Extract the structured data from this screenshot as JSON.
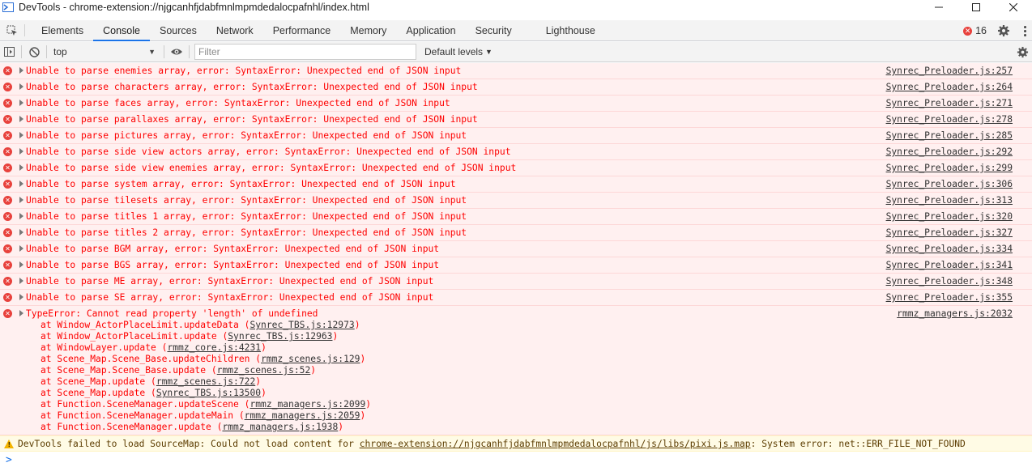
{
  "window": {
    "title": "DevTools - chrome-extension://njgcanhfjdabfmnlmpmdedalocpafnhl/index.html"
  },
  "tabs": [
    {
      "label": "Elements"
    },
    {
      "label": "Console"
    },
    {
      "label": "Sources"
    },
    {
      "label": "Network"
    },
    {
      "label": "Performance"
    },
    {
      "label": "Memory"
    },
    {
      "label": "Application"
    },
    {
      "label": "Security"
    },
    {
      "label": "Lighthouse"
    }
  ],
  "active_tab": "Console",
  "error_count": "16",
  "toolbar": {
    "context": "top",
    "filter_placeholder": "Filter",
    "levels": "Default levels"
  },
  "errors": [
    {
      "text": "Unable to parse enemies array, error: SyntaxError: Unexpected end of JSON input",
      "source": "Synrec_Preloader.js:257"
    },
    {
      "text": "Unable to parse characters array, error: SyntaxError: Unexpected end of JSON input",
      "source": "Synrec_Preloader.js:264"
    },
    {
      "text": "Unable to parse faces array, error: SyntaxError: Unexpected end of JSON input",
      "source": "Synrec_Preloader.js:271"
    },
    {
      "text": "Unable to parse parallaxes array, error: SyntaxError: Unexpected end of JSON input",
      "source": "Synrec_Preloader.js:278"
    },
    {
      "text": "Unable to parse pictures array, error: SyntaxError: Unexpected end of JSON input",
      "source": "Synrec_Preloader.js:285"
    },
    {
      "text": "Unable to parse side view actors array, error: SyntaxError: Unexpected end of JSON input",
      "source": "Synrec_Preloader.js:292"
    },
    {
      "text": "Unable to parse side view enemies array, error: SyntaxError: Unexpected end of JSON input",
      "source": "Synrec_Preloader.js:299"
    },
    {
      "text": "Unable to parse system array, error: SyntaxError: Unexpected end of JSON input",
      "source": "Synrec_Preloader.js:306"
    },
    {
      "text": "Unable to parse tilesets array, error: SyntaxError: Unexpected end of JSON input",
      "source": "Synrec_Preloader.js:313"
    },
    {
      "text": "Unable to parse titles 1 array, error: SyntaxError: Unexpected end of JSON input",
      "source": "Synrec_Preloader.js:320"
    },
    {
      "text": "Unable to parse titles 2 array, error: SyntaxError: Unexpected end of JSON input",
      "source": "Synrec_Preloader.js:327"
    },
    {
      "text": "Unable to parse BGM array, error: SyntaxError: Unexpected end of JSON input",
      "source": "Synrec_Preloader.js:334"
    },
    {
      "text": "Unable to parse BGS array, error: SyntaxError: Unexpected end of JSON input",
      "source": "Synrec_Preloader.js:341"
    },
    {
      "text": "Unable to parse ME array, error: SyntaxError: Unexpected end of JSON input",
      "source": "Synrec_Preloader.js:348"
    },
    {
      "text": "Unable to parse SE array, error: SyntaxError: Unexpected end of JSON input",
      "source": "Synrec_Preloader.js:355"
    }
  ],
  "type_error": {
    "text": "TypeError: Cannot read property 'length' of undefined",
    "source": "rmmz_managers.js:2032",
    "frames": [
      {
        "pre": "at Window_ActorPlaceLimit.updateData (",
        "link": "Synrec_TBS.js:12973",
        "post": ")"
      },
      {
        "pre": "at Window_ActorPlaceLimit.update (",
        "link": "Synrec_TBS.js:12963",
        "post": ")"
      },
      {
        "pre": "at WindowLayer.update (",
        "link": "rmmz_core.js:4231",
        "post": ")"
      },
      {
        "pre": "at Scene_Map.Scene_Base.updateChildren (",
        "link": "rmmz_scenes.js:129",
        "post": ")"
      },
      {
        "pre": "at Scene_Map.Scene_Base.update (",
        "link": "rmmz_scenes.js:52",
        "post": ")"
      },
      {
        "pre": "at Scene_Map.update (",
        "link": "rmmz_scenes.js:722",
        "post": ")"
      },
      {
        "pre": "at Scene_Map.update (",
        "link": "Synrec_TBS.js:13500",
        "post": ")"
      },
      {
        "pre": "at Function.SceneManager.updateScene (",
        "link": "rmmz_managers.js:2099",
        "post": ")"
      },
      {
        "pre": "at Function.SceneManager.updateMain (",
        "link": "rmmz_managers.js:2059",
        "post": ")"
      },
      {
        "pre": "at Function.SceneManager.update (",
        "link": "rmmz_managers.js:1938",
        "post": ")"
      }
    ]
  },
  "warning": {
    "pre": "DevTools failed to load SourceMap: Could not load content for ",
    "link": "chrome-extension://njgcanhfjdabfmnlmpmdedalocpafnhl/js/libs/pixi.js.map",
    "post": ": System error: net::ERR_FILE_NOT_FOUND"
  },
  "prompt_symbol": ">"
}
